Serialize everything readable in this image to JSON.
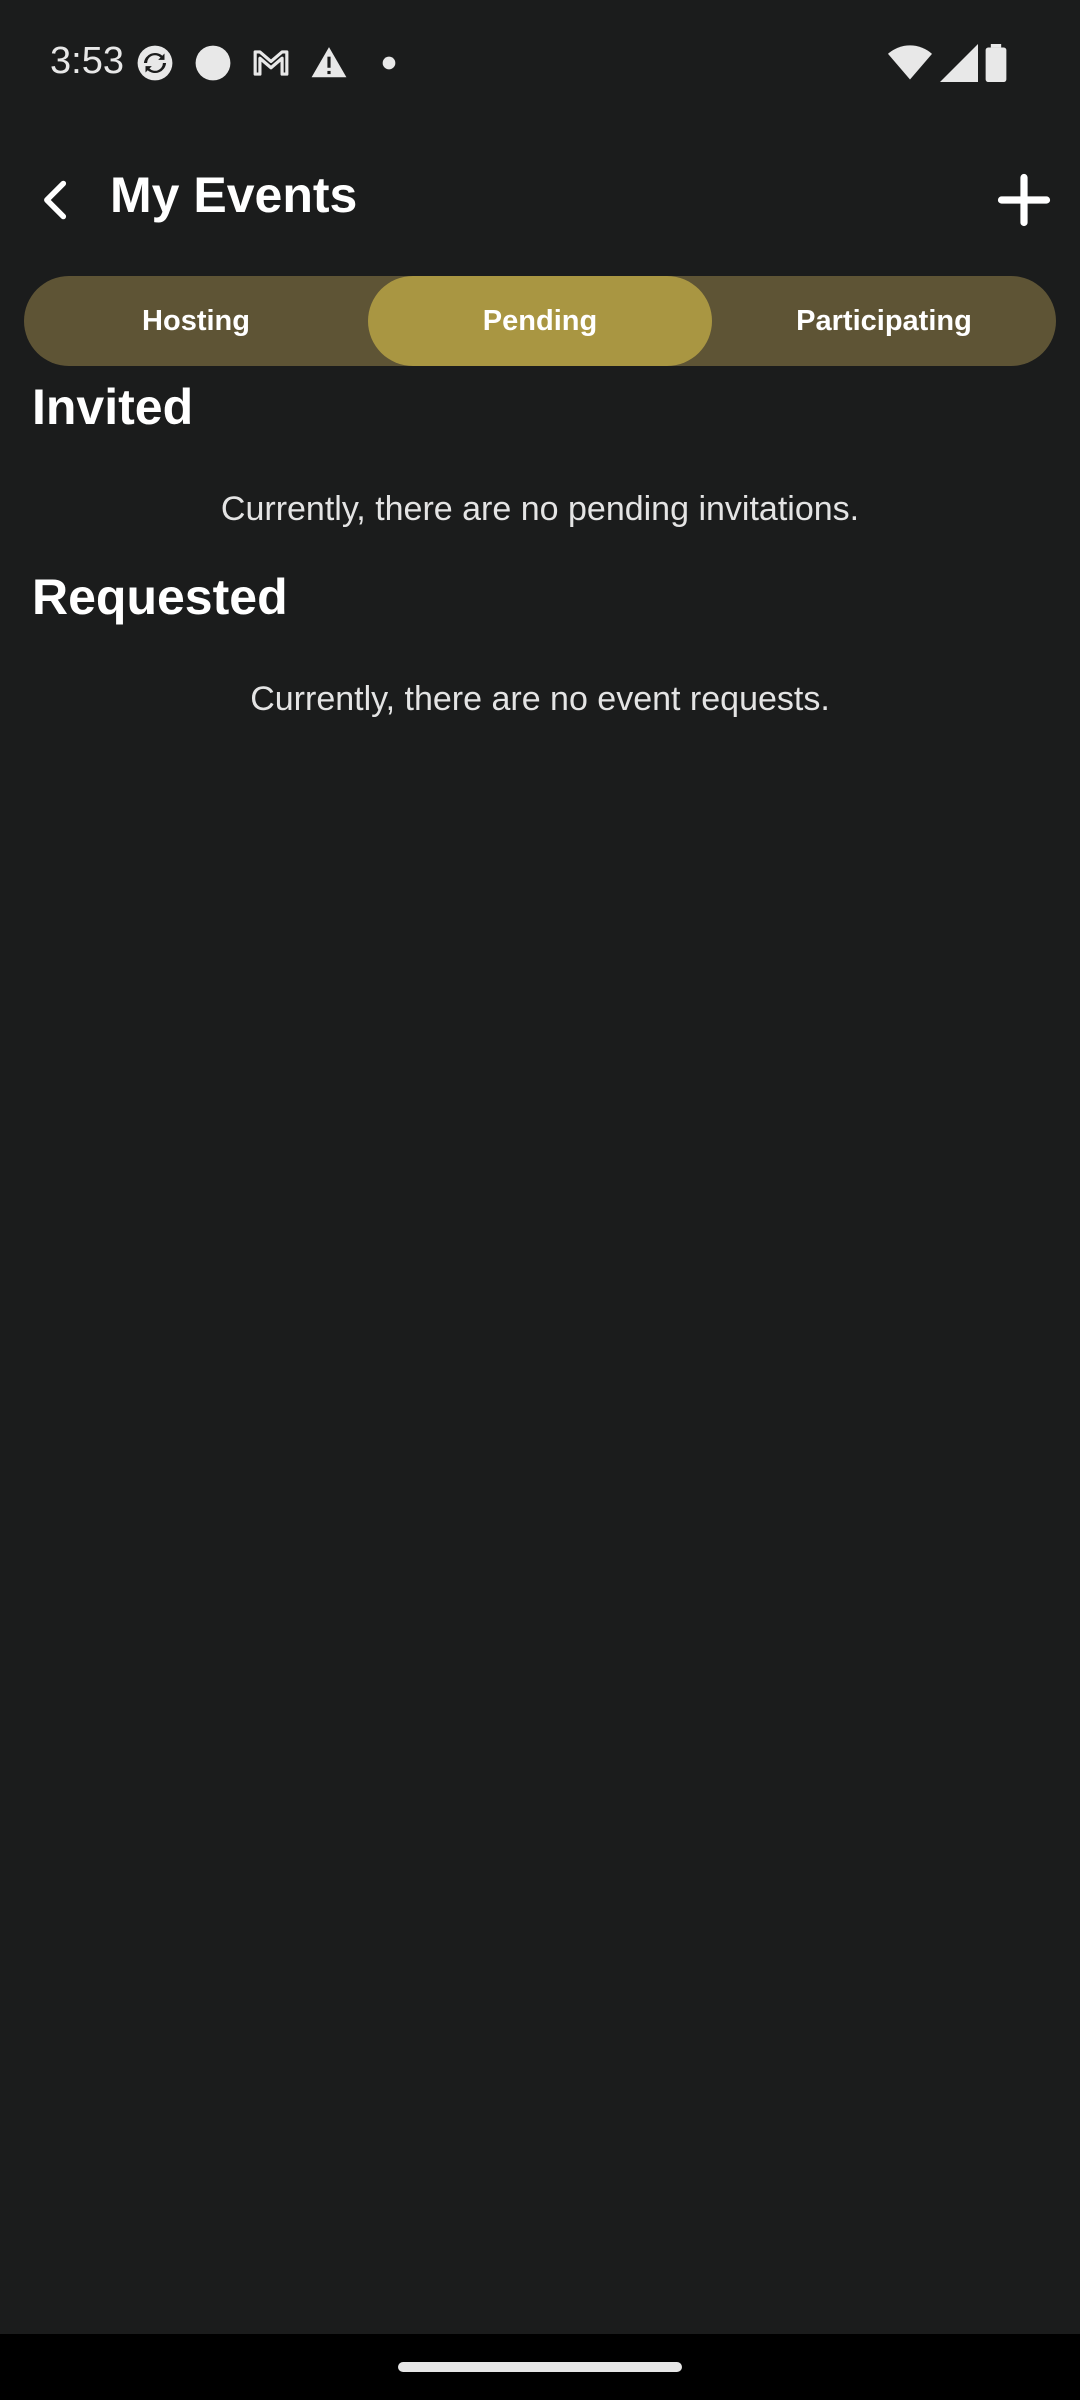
{
  "status_bar": {
    "time": "3:53",
    "left_icons": [
      "sync-icon",
      "circle-notification-icon",
      "gmail-icon",
      "warning-icon",
      "dot-icon"
    ],
    "right_icons": [
      "wifi-icon",
      "cell-signal-icon",
      "battery-icon"
    ]
  },
  "app_bar": {
    "title": "My Events",
    "back_icon": "chevron-left-icon",
    "add_icon": "plus-icon"
  },
  "tabs": [
    {
      "label": "Hosting",
      "active": false
    },
    {
      "label": "Pending",
      "active": true
    },
    {
      "label": "Participating",
      "active": false
    }
  ],
  "sections": {
    "invited": {
      "heading": "Invited",
      "empty_message": "Currently, there are no pending invitations."
    },
    "requested": {
      "heading": "Requested",
      "empty_message": "Currently, there are no event requests."
    }
  },
  "colors": {
    "background": "#1b1c1c",
    "tab_track": "#5e5435",
    "tab_active": "#a99642"
  }
}
